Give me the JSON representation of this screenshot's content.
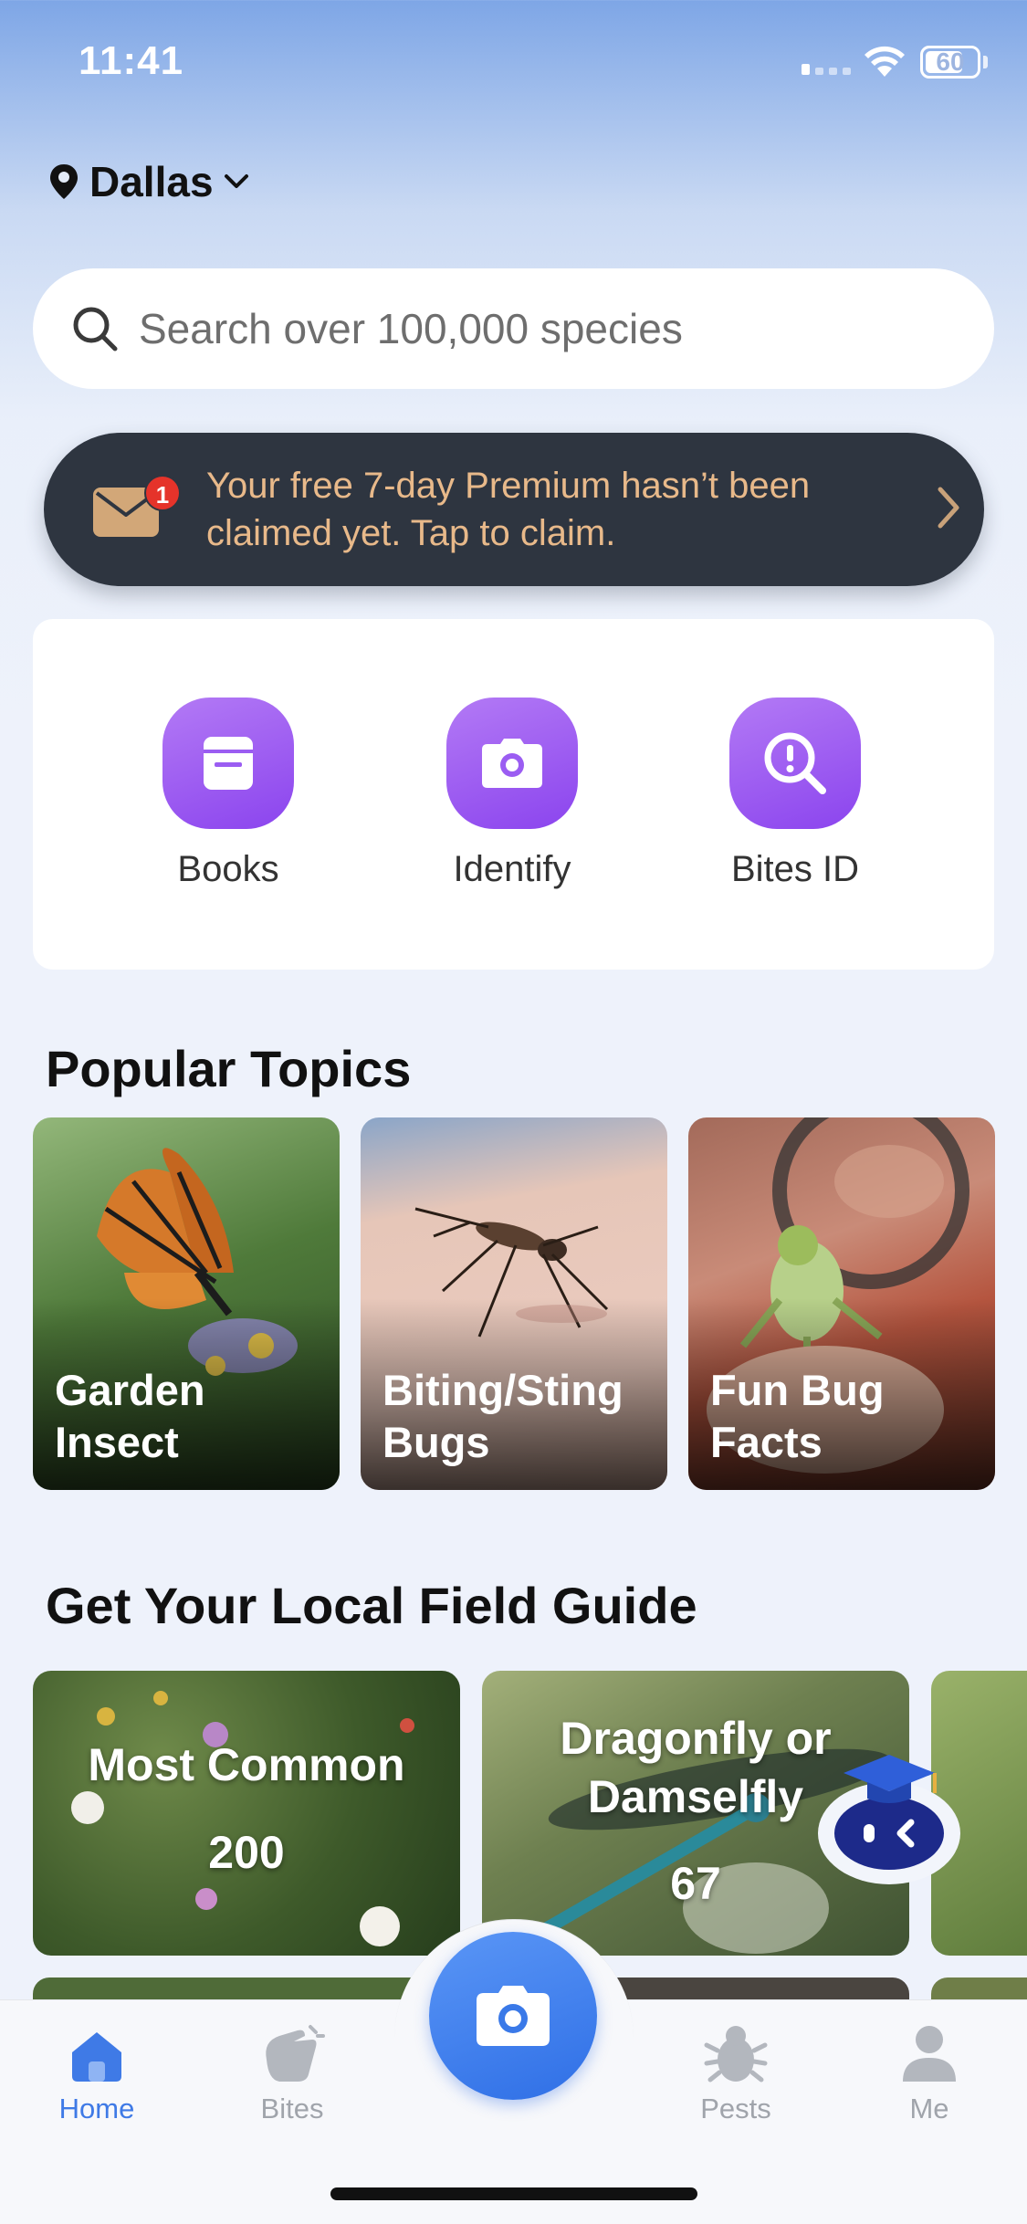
{
  "status_bar": {
    "time": "11:41",
    "battery": "60"
  },
  "location": {
    "city": "Dallas"
  },
  "search": {
    "placeholder": "Search over 100,000 species"
  },
  "premium_banner": {
    "badge_count": "1",
    "text": "Your free 7-day Premium hasn’t been claimed yet. Tap to claim."
  },
  "quick_actions": [
    {
      "label": "Books",
      "icon": "book-icon"
    },
    {
      "label": "Identify",
      "icon": "camera-icon"
    },
    {
      "label": "Bites ID",
      "icon": "magnifier-alert-icon"
    }
  ],
  "popular_topics": {
    "title": "Popular Topics",
    "items": [
      {
        "label": "Garden Insect"
      },
      {
        "label": "Biting/Sting Bugs"
      },
      {
        "label": "Fun Bug Facts"
      }
    ]
  },
  "field_guide": {
    "title": "Get Your Local Field Guide",
    "items": [
      {
        "name": "Most Common",
        "count": "200"
      },
      {
        "name": "Dragonfly or Damselfly",
        "count": "67"
      }
    ]
  },
  "tab_bar": {
    "tabs": [
      {
        "label": "Home",
        "icon": "home-icon",
        "active": true
      },
      {
        "label": "Bites",
        "icon": "hand-icon",
        "active": false
      },
      {
        "label": "Pests",
        "icon": "bug-icon",
        "active": false
      },
      {
        "label": "Me",
        "icon": "person-icon",
        "active": false
      }
    ],
    "center_icon": "camera-icon"
  },
  "colors": {
    "accent_purple": "#8b44ee",
    "accent_blue": "#3f7ae6",
    "banner_bg": "#2e3540",
    "banner_text": "#e8b98a",
    "badge_red": "#e5332a"
  }
}
